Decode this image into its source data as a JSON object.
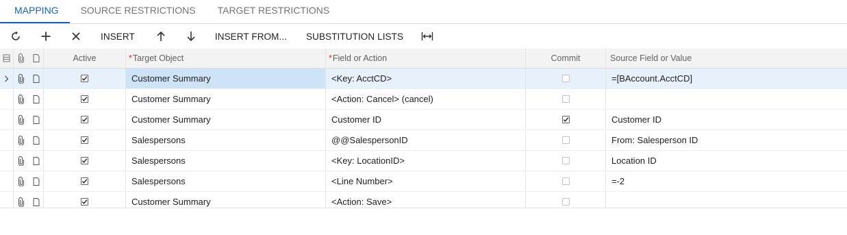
{
  "tabs": [
    {
      "label": "MAPPING",
      "active": true
    },
    {
      "label": "SOURCE RESTRICTIONS",
      "active": false
    },
    {
      "label": "TARGET RESTRICTIONS",
      "active": false
    }
  ],
  "toolbar": {
    "refresh_icon": "refresh-icon",
    "add_icon": "plus-icon",
    "delete_icon": "close-icon",
    "insert_label": "INSERT",
    "move_up_icon": "arrow-up-icon",
    "move_down_icon": "arrow-down-icon",
    "insert_from_label": "INSERT FROM...",
    "substitution_lists_label": "SUBSTITUTION LISTS",
    "fit_columns_icon": "fit-columns-icon"
  },
  "grid": {
    "columns": {
      "active": "Active",
      "target_object": "Target Object",
      "field_or_action": "Field or Action",
      "commit": "Commit",
      "source_field": "Source Field or Value"
    },
    "required_marker": "*",
    "rows": [
      {
        "active": true,
        "target_object": "Customer Summary",
        "field_or_action": "<Key: AcctCD>",
        "commit": false,
        "source": "=[BAccount.AcctCD]",
        "selected": true
      },
      {
        "active": true,
        "target_object": "Customer Summary",
        "field_or_action": "<Action: Cancel> (cancel)",
        "commit": false,
        "source": ""
      },
      {
        "active": true,
        "target_object": "Customer Summary",
        "field_or_action": "Customer ID",
        "commit": true,
        "source": "Customer ID"
      },
      {
        "active": true,
        "target_object": "Salespersons",
        "field_or_action": "@@SalespersonID",
        "commit": false,
        "source": "From: Salesperson ID"
      },
      {
        "active": true,
        "target_object": "Salespersons",
        "field_or_action": "<Key: LocationID>",
        "commit": false,
        "source": "Location ID"
      },
      {
        "active": true,
        "target_object": "Salespersons",
        "field_or_action": "<Line Number>",
        "commit": false,
        "source": "=-2"
      },
      {
        "active": true,
        "target_object": "Customer Summary",
        "field_or_action": "<Action: Save>",
        "commit": false,
        "source": ""
      }
    ]
  },
  "colors": {
    "accent": "#1565c0",
    "selected_row": "#e6f1fb",
    "selected_cell": "#cfe3f6",
    "required": "#d32f2f"
  }
}
